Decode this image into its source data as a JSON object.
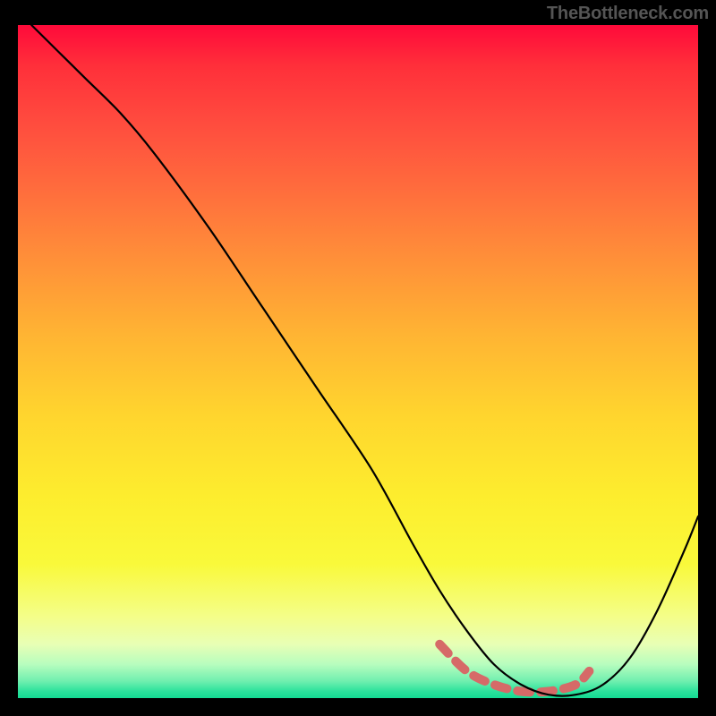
{
  "watermark": "TheBottleneck.com",
  "chart_data": {
    "type": "line",
    "title": "",
    "xlabel": "",
    "ylabel": "",
    "xlim": [
      0,
      100
    ],
    "ylim": [
      0,
      100
    ],
    "grid": false,
    "legend": false,
    "background_gradient": {
      "direction": "vertical",
      "stops": [
        {
          "pos": 0.0,
          "color": "#ff0a3a"
        },
        {
          "pos": 0.5,
          "color": "#ffc22f"
        },
        {
          "pos": 0.8,
          "color": "#f9f93a"
        },
        {
          "pos": 1.0,
          "color": "#13da93"
        }
      ]
    },
    "series": [
      {
        "name": "bottleneck-curve",
        "color": "#000000",
        "x": [
          2,
          6,
          10,
          15,
          20,
          28,
          36,
          44,
          52,
          58,
          62,
          66,
          70,
          74,
          78,
          82,
          86,
          90,
          94,
          98,
          100
        ],
        "y": [
          100,
          96,
          92,
          87,
          81,
          70,
          58,
          46,
          34,
          23,
          16,
          10,
          5,
          2,
          0.5,
          0.5,
          2,
          6,
          13,
          22,
          27
        ]
      }
    ],
    "annotations": [
      {
        "name": "optimal-trough",
        "style": "dashed",
        "color": "#d66a68",
        "x": [
          62,
          66,
          70,
          74,
          78,
          82,
          84
        ],
        "y": [
          8,
          4,
          2,
          1,
          1,
          2,
          4
        ]
      }
    ]
  }
}
